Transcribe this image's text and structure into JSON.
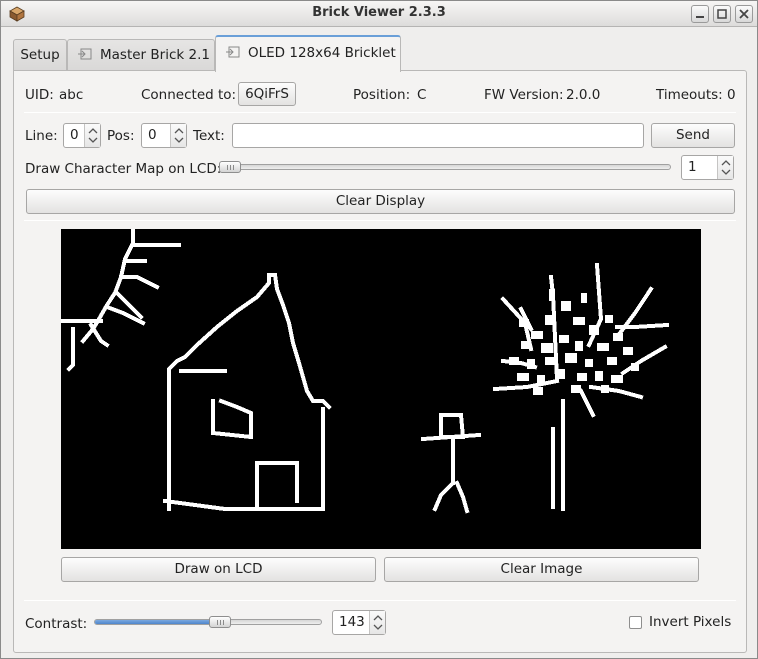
{
  "window": {
    "title": "Brick Viewer 2.3.3"
  },
  "tabs": [
    {
      "label": "Setup"
    },
    {
      "label": "Master Brick 2.1"
    },
    {
      "label": "OLED 128x64 Bricklet"
    }
  ],
  "info": {
    "uid_label": "UID:",
    "uid_value": "abc",
    "connected_label": "Connected to:",
    "connected_value": "6QiFrS",
    "position_label": "Position:",
    "position_value": "C",
    "fw_label": "FW Version:",
    "fw_value": "2.0.0",
    "timeouts_label": "Timeouts:",
    "timeouts_value": "0"
  },
  "text_row": {
    "line_label": "Line:",
    "line_value": "0",
    "pos_label": "Pos:",
    "pos_value": "0",
    "text_label": "Text:",
    "text_value": "",
    "send_label": "Send"
  },
  "charmap": {
    "label": "Draw Character Map on LCD:",
    "value": "1"
  },
  "clear_display_label": "Clear Display",
  "draw_lcd_label": "Draw on LCD",
  "clear_image_label": "Clear Image",
  "contrast": {
    "label": "Contrast:",
    "value": "143",
    "level_fraction": 0.56
  },
  "invert": {
    "label": "Invert Pixels",
    "checked": false
  }
}
